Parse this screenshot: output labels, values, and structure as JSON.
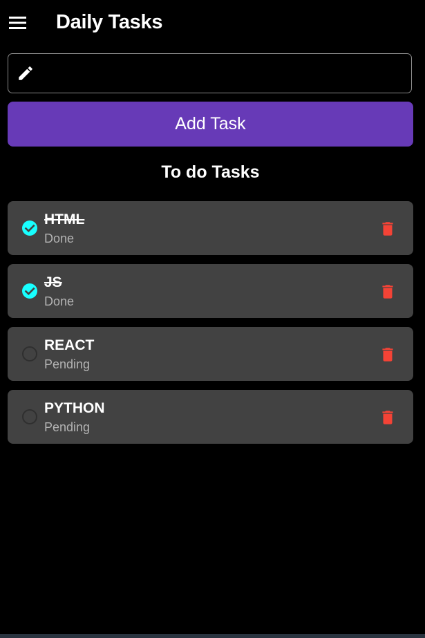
{
  "app_bar": {
    "menu_icon": "menu-icon",
    "title": "Daily Tasks"
  },
  "new_task": {
    "icon": "pencil-icon",
    "value": "",
    "placeholder": ""
  },
  "add_button": {
    "label": "Add Task",
    "color": "#673ab7"
  },
  "section": {
    "title": "To do Tasks"
  },
  "tasks": [
    {
      "name": "HTML",
      "status": "Done",
      "completed": true
    },
    {
      "name": "JS",
      "status": "Done",
      "completed": true
    },
    {
      "name": "REACT",
      "status": "Pending",
      "completed": false
    },
    {
      "name": "PYTHON",
      "status": "Pending",
      "completed": false
    }
  ],
  "colors": {
    "background": "#000000",
    "card": "#424242",
    "check": "#18ffff",
    "delete": "#f44336",
    "status_text": "#b3b3b3"
  },
  "icons": {
    "check": "check-circle-icon",
    "unchecked": "empty-circle-icon",
    "delete": "trash-icon"
  }
}
